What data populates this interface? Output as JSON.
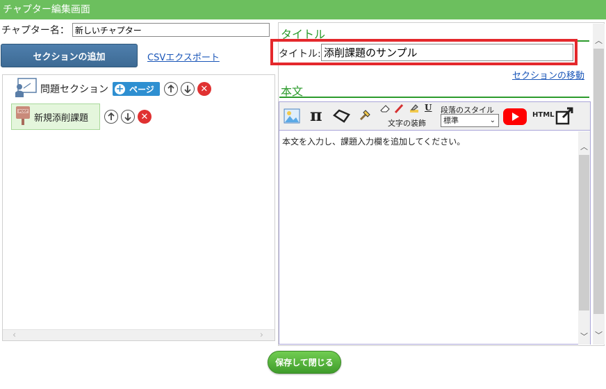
{
  "window": {
    "title": "チャプター編集画面"
  },
  "chapter": {
    "label": "チャプター名：",
    "value": "新しいチャプター"
  },
  "actions": {
    "add_section": "セクションの追加",
    "csv_export": "CSVエクスポート"
  },
  "tree": {
    "section": {
      "label": "問題セクション",
      "page_button": "ページ"
    },
    "page_item": {
      "label": "新規添削課題"
    }
  },
  "right": {
    "title_heading": "タイトル",
    "title_label": "タイトル:",
    "title_value": "添削課題のサンプル",
    "move_section": "セクションの移動",
    "body_heading": "本文"
  },
  "editor": {
    "toolbar": {
      "text_decoration_label": "文字の装飾",
      "paragraph_style_label": "段落のスタイル",
      "paragraph_style_value": "標準",
      "html_label": "HTML",
      "pi_label": "π",
      "underline_label": "U"
    },
    "content": "本文を入力し、課題入力欄を追加してください。"
  },
  "footer": {
    "save_close": "保存して閉じる"
  },
  "colors": {
    "header_green": "#6cbf5e",
    "heading_green": "#2b9a2b",
    "highlight_red": "#e4282c",
    "primary_blue": "#3d6a94",
    "page_blue": "#2e8fd1"
  }
}
